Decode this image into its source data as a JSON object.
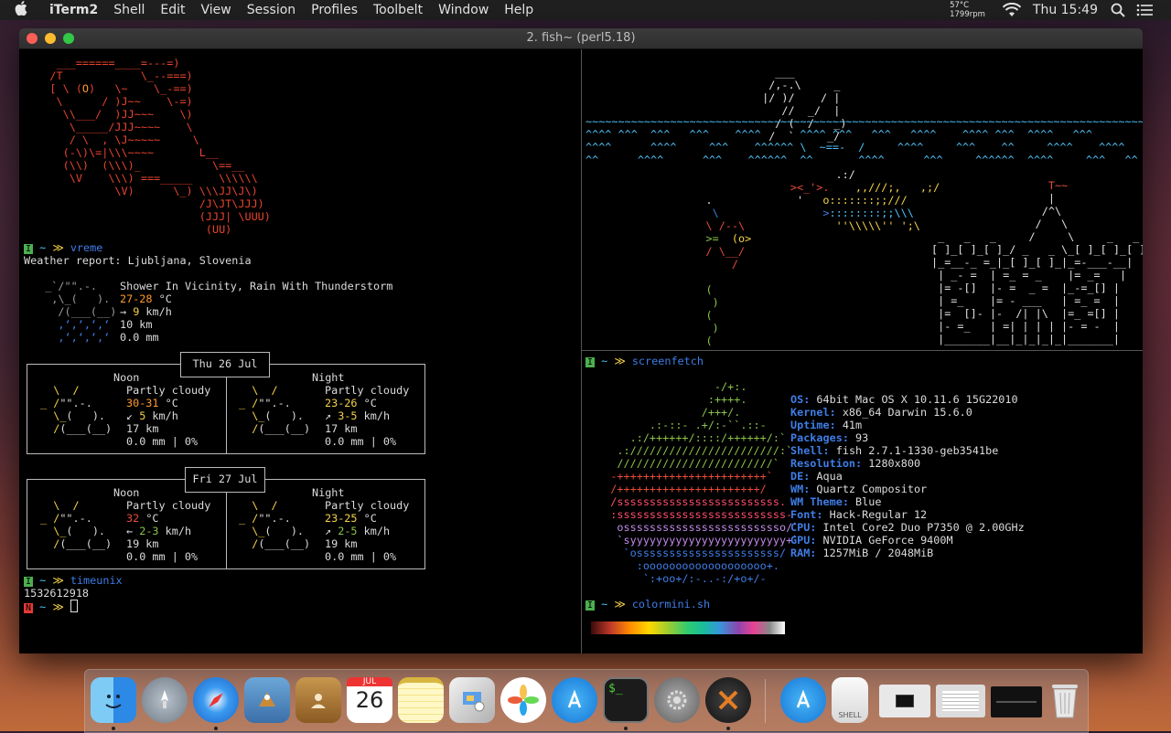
{
  "menubar": {
    "app_name": "iTerm2",
    "items": [
      "Shell",
      "Edit",
      "View",
      "Session",
      "Profiles",
      "Toolbelt",
      "Window",
      "Help"
    ],
    "temp_line1": "57°C",
    "temp_line2": "1799rpm",
    "clock": "Thu 15:49"
  },
  "window": {
    "title": "2. fish~ (perl5.18)"
  },
  "left_pane": {
    "prompt1_cmd": "vreme",
    "weather_report": "Weather report: Ljubljana, Slovenia",
    "current": {
      "condition": "Shower In Vicinity, Rain With Thunderstorm",
      "temp_value": "27-28",
      "temp_unit": " °C",
      "wind_arrow": "→ ",
      "wind_value": "9",
      "wind_unit": " km/h",
      "visibility": "10 km",
      "precip": "0.0 mm"
    },
    "day1": {
      "date": "Thu 26 Jul",
      "noon_label": "Noon",
      "night_label": "Night",
      "noon": {
        "condition": "Partly cloudy",
        "temp": "30-31",
        "wind_arrow": "↙ ",
        "wind": "5",
        "vis": "17 km",
        "precip": "0.0 mm | 0%"
      },
      "night": {
        "condition": "Partly cloudy",
        "temp": "23-26",
        "wind_arrow": "↗ ",
        "wind": "3-5",
        "vis": "17 km",
        "precip": "0.0 mm | 0%"
      }
    },
    "day2": {
      "date": "Fri 27 Jul",
      "noon_label": "Noon",
      "night_label": "Night",
      "noon": {
        "condition": "Partly cloudy",
        "temp": "32",
        "wind_arrow": "← ",
        "wind": "2-3",
        "vis": "19 km",
        "precip": "0.0 mm | 0%"
      },
      "night": {
        "condition": "Partly cloudy",
        "temp": "23-25",
        "wind_arrow": "↗ ",
        "wind": "2-5",
        "vis": "19 km",
        "precip": "0.0 mm | 0%"
      }
    },
    "temp_unit": " °C",
    "wind_unit": " km/h",
    "prompt2_cmd": "timeunix",
    "unix_output": "1532612918"
  },
  "right_bottom_pane": {
    "prompt1_cmd": "screenfetch",
    "info": [
      {
        "key": "OS:",
        "value": "64bit Mac OS X 10.11.6 15G22010"
      },
      {
        "key": "Kernel:",
        "value": "x86_64 Darwin 15.6.0"
      },
      {
        "key": "Uptime:",
        "value": "41m"
      },
      {
        "key": "Packages:",
        "value": "93"
      },
      {
        "key": "Shell:",
        "value": "fish 2.7.1-1330-geb3541be"
      },
      {
        "key": "Resolution:",
        "value": "1280x800"
      },
      {
        "key": "DE:",
        "value": "Aqua"
      },
      {
        "key": "WM:",
        "value": "Quartz Compositor"
      },
      {
        "key": "WM Theme:",
        "value": "Blue"
      },
      {
        "key": "Font:",
        "value": "Hack-Regular 12"
      },
      {
        "key": "CPU:",
        "value": "Intel Core2 Duo P7350 @ 2.00GHz"
      },
      {
        "key": "GPU:",
        "value": "NVIDIA GeForce 9400M"
      },
      {
        "key": "RAM:",
        "value": "1257MiB / 2048MiB"
      }
    ],
    "prompt2_cmd": "colormini.sh"
  },
  "dock": {
    "calendar_month": "JUL",
    "calendar_day": "26",
    "shell_label": "SHELL"
  },
  "colors": {
    "prompt_green": "#4caf50",
    "prompt_red": "#e53935",
    "command_blue": "#3f7ee8",
    "key_blue": "#3f7ee8"
  }
}
